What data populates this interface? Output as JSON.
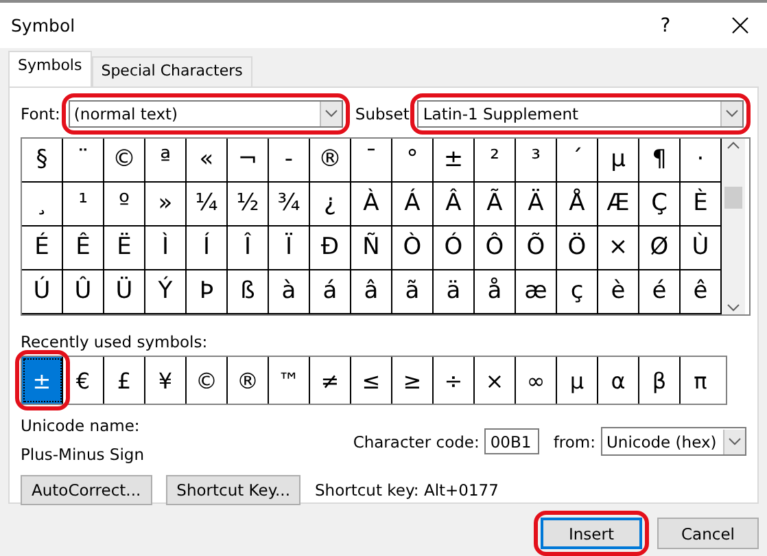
{
  "window": {
    "title": "Symbol",
    "help": "?"
  },
  "tabs": [
    {
      "label": "Symbols",
      "selected": true
    },
    {
      "label": "Special Characters",
      "selected": false
    }
  ],
  "font": {
    "label": "Font:",
    "value": "(normal text)",
    "highlighted": true
  },
  "subset": {
    "label": "Subset",
    "value": "Latin-1 Supplement",
    "highlighted": true
  },
  "grid": [
    [
      "§",
      "¨",
      "©",
      "ª",
      "«",
      "¬",
      "-",
      "®",
      "¯",
      "°",
      "±",
      "²",
      "³",
      "´",
      "µ",
      "¶",
      "·"
    ],
    [
      "¸",
      "¹",
      "º",
      "»",
      "¼",
      "½",
      "¾",
      "¿",
      "À",
      "Á",
      "Â",
      "Ã",
      "Ä",
      "Å",
      "Æ",
      "Ç",
      "È"
    ],
    [
      "É",
      "Ê",
      "Ë",
      "Ì",
      "Í",
      "Î",
      "Ï",
      "Ð",
      "Ñ",
      "Ò",
      "Ó",
      "Ô",
      "Õ",
      "Ö",
      "×",
      "Ø",
      "Ù"
    ],
    [
      "Ú",
      "Û",
      "Ü",
      "Ý",
      "Þ",
      "ß",
      "à",
      "á",
      "â",
      "ã",
      "ä",
      "å",
      "æ",
      "ç",
      "è",
      "é",
      "ê"
    ]
  ],
  "recent": {
    "label": "Recently used symbols:",
    "symbols": [
      {
        "char": "±",
        "selected": true,
        "highlighted": true
      },
      {
        "char": "€",
        "selected": false,
        "highlighted": false
      },
      {
        "char": "£",
        "selected": false,
        "highlighted": false
      },
      {
        "char": "¥",
        "selected": false,
        "highlighted": false
      },
      {
        "char": "©",
        "selected": false,
        "highlighted": false
      },
      {
        "char": "®",
        "selected": false,
        "highlighted": false
      },
      {
        "char": "™",
        "selected": false,
        "highlighted": false
      },
      {
        "char": "≠",
        "selected": false,
        "highlighted": false
      },
      {
        "char": "≤",
        "selected": false,
        "highlighted": false
      },
      {
        "char": "≥",
        "selected": false,
        "highlighted": false
      },
      {
        "char": "÷",
        "selected": false,
        "highlighted": false
      },
      {
        "char": "×",
        "selected": false,
        "highlighted": false
      },
      {
        "char": "∞",
        "selected": false,
        "highlighted": false
      },
      {
        "char": "µ",
        "selected": false,
        "highlighted": false
      },
      {
        "char": "α",
        "selected": false,
        "highlighted": false
      },
      {
        "char": "β",
        "selected": false,
        "highlighted": false
      },
      {
        "char": "π",
        "selected": false,
        "highlighted": false
      }
    ]
  },
  "unicode_name": {
    "label": "Unicode name:",
    "value": "Plus-Minus Sign"
  },
  "character_code": {
    "label": "Character code:",
    "value": "00B1"
  },
  "from": {
    "label": "from:",
    "value": "Unicode (hex)"
  },
  "panel_buttons": [
    "AutoCorrect...",
    "Shortcut Key..."
  ],
  "shortcut_key": "Shortcut key: Alt+0177",
  "dialog_buttons": [
    {
      "label": "Insert",
      "default": true,
      "highlighted": true
    },
    {
      "label": "Cancel",
      "default": false,
      "highlighted": false
    }
  ]
}
